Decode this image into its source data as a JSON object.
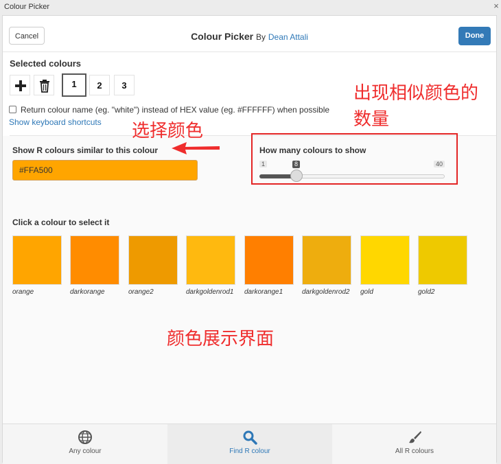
{
  "window": {
    "title": "Colour Picker",
    "close_icon": "×"
  },
  "header": {
    "cancel_label": "Cancel",
    "title": "Colour Picker",
    "by": "By",
    "author": "Dean Attali",
    "done_label": "Done"
  },
  "selected": {
    "title": "Selected colours",
    "slots": [
      "1",
      "2",
      "3"
    ],
    "active_slot": "1"
  },
  "options": {
    "return_name_label": "Return colour name (eg. \"white\") instead of HEX value (eg. #FFFFFF) when possible",
    "keyboard_link": "Show keyboard shortcuts"
  },
  "find": {
    "similar_label": "Show R colours similar to this colour",
    "hex_value": "#FFA500",
    "howmany_label": "How many colours to show",
    "slider": {
      "min": "1",
      "max": "40",
      "value": "8"
    },
    "click_label": "Click a colour to select it",
    "swatches": [
      {
        "name": "orange",
        "color": "#FFA500"
      },
      {
        "name": "darkorange",
        "color": "#FF8C00"
      },
      {
        "name": "orange2",
        "color": "#EE9A00"
      },
      {
        "name": "darkgoldenrod1",
        "color": "#FFB90F"
      },
      {
        "name": "darkorange1",
        "color": "#FF7F00"
      },
      {
        "name": "darkgoldenrod2",
        "color": "#EEAD0E"
      },
      {
        "name": "gold",
        "color": "#FFD700"
      },
      {
        "name": "gold2",
        "color": "#EEC900"
      }
    ]
  },
  "tabs": [
    {
      "label": "Any colour",
      "icon": "globe-icon"
    },
    {
      "label": "Find R colour",
      "icon": "search-icon"
    },
    {
      "label": "All R colours",
      "icon": "paintbrush-icon"
    }
  ],
  "annotations": {
    "count_note_line1": "出现相似颜色的",
    "count_note_line2": "数量",
    "select_note": "选择颜色",
    "display_note": "颜色展示界面",
    "color": "#EF2D2D"
  }
}
